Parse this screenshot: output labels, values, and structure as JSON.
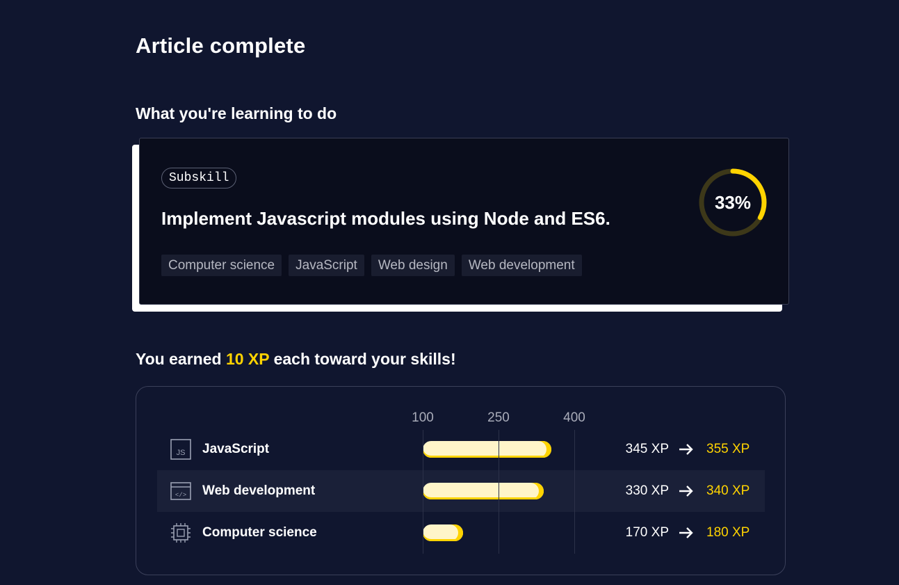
{
  "page": {
    "title": "Article complete"
  },
  "learning": {
    "heading": "What you're learning to do",
    "card": {
      "badge": "Subskill",
      "title": "Implement Javascript modules using Node and ES6.",
      "tags": [
        "Computer science",
        "JavaScript",
        "Web design",
        "Web development"
      ],
      "progress_percent": 33,
      "progress_label": "33%"
    }
  },
  "xp": {
    "heading_prefix": "You earned ",
    "heading_amount": "10 XP",
    "heading_suffix": " each toward your skills!",
    "axis_ticks": [
      "100",
      "250",
      "400"
    ],
    "skills": [
      {
        "name": "JavaScript",
        "icon": "js-file-icon",
        "value": 355,
        "from": "345 XP",
        "to": "355 XP"
      },
      {
        "name": "Web development",
        "icon": "code-window-icon",
        "value": 340,
        "from": "330 XP",
        "to": "340 XP"
      },
      {
        "name": "Computer science",
        "icon": "cpu-chip-icon",
        "value": 180,
        "from": "170 XP",
        "to": "180 XP"
      }
    ]
  },
  "colors": {
    "background": "#10162f",
    "accent": "#ffd300",
    "card": "#0a0d1c",
    "bar_fill": "#fff5c9"
  }
}
